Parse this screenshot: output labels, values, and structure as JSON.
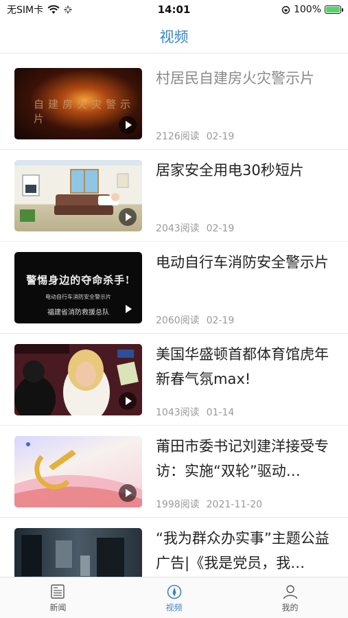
{
  "status_bar": {
    "carrier": "无SIM卡",
    "time": "14:01",
    "battery_percent": "100%",
    "battery_level": 1.0,
    "icons": [
      "wifi-icon",
      "loading-icon",
      "orientation-lock-icon",
      "battery-charging-icon"
    ]
  },
  "nav": {
    "title": "视频"
  },
  "videos": [
    {
      "title": "村居民自建房火灾警示片",
      "views": "2126阅读",
      "date": "02-19",
      "thumb_text": "自建房火灾警示片"
    },
    {
      "title": "居家安全用电30秒短片",
      "views": "2043阅读",
      "date": "02-19"
    },
    {
      "title": "电动自行车消防安全警示片",
      "views": "2060阅读",
      "date": "02-19",
      "thumb_text": "警惕身边的夺命杀手!",
      "thumb_sub": "电动自行车消防安全警示片",
      "thumb_org": "福建省消防救援总队"
    },
    {
      "title": "美国华盛顿首都体育馆虎年新春气氛max!",
      "views": "1043阅读",
      "date": "01-14"
    },
    {
      "title": "莆田市委书记刘建洋接受专访：实施“双轮”驱动…",
      "views": "1998阅读",
      "date": "2021-11-20"
    },
    {
      "title": "“我为群众办实事”主题公益广告|《我是党员，我…",
      "views": "",
      "date": ""
    }
  ],
  "tabs": [
    {
      "label": "新闻",
      "icon": "newspaper-icon",
      "active": false
    },
    {
      "label": "视频",
      "icon": "video-compass-icon",
      "active": true
    },
    {
      "label": "我的",
      "icon": "user-icon",
      "active": false
    }
  ],
  "colors": {
    "accent": "#3b83c7",
    "text": "#222222",
    "meta": "#999999"
  }
}
